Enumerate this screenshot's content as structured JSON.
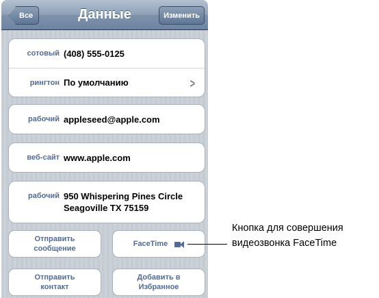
{
  "navbar": {
    "back_label": "Все",
    "title": "Данные",
    "edit_label": "Изменить"
  },
  "phone_group": [
    {
      "label": "сотовый",
      "value": "(408) 555-0125"
    },
    {
      "label": "рингтон",
      "value": "По умолчанию"
    }
  ],
  "email": {
    "label": "рабочий",
    "value": "appleseed@apple.com"
  },
  "website": {
    "label": "веб-сайт",
    "value": "www.apple.com"
  },
  "address": {
    "label": "рабочий",
    "line1": "950 Whispering Pines Circle",
    "line2": "Seagoville TX 75159"
  },
  "buttons": {
    "send_message_line1": "Отправить",
    "send_message_line2": "сообщение",
    "facetime": "FaceTime",
    "share_contact_line1": "Отправить",
    "share_contact_line2": "контакт",
    "favorites_line1": "Добавить в",
    "favorites_line2": "Избранное"
  },
  "icons": {
    "facetime": "video-camera-icon",
    "ringtone_chevron": "chevron-right-icon"
  },
  "callout": {
    "line1": "Кнопка для совершения",
    "line2": "видеозвонка FaceTime"
  },
  "colors": {
    "label_blue": "#526b96",
    "navbar": "#6d84a2",
    "background": "#c5ccd4"
  }
}
